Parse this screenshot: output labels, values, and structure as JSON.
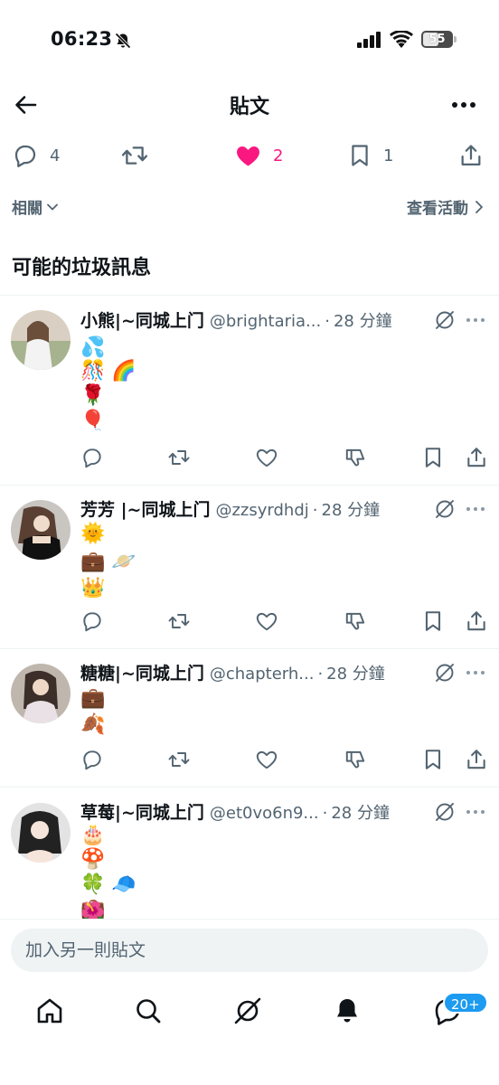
{
  "status_bar": {
    "time": "06:23",
    "battery_level": "55"
  },
  "header": {
    "title": "貼文"
  },
  "engagement": {
    "replies": "4",
    "likes": "2",
    "bookmarks": "1"
  },
  "filters": {
    "related": "相關",
    "view_activity": "查看活動"
  },
  "section": {
    "spam_heading": "可能的垃圾訊息"
  },
  "posts": [
    {
      "name": "小熊|~同城上门",
      "handle": "@brightaria...",
      "dot": "·",
      "time": "28 分鐘",
      "emoji": [
        "💦",
        "🎊 🌈",
        "🌹",
        "🎈"
      ]
    },
    {
      "name": "芳芳 |~同城上门",
      "handle": "@zzsyrdhdj",
      "dot": "·",
      "time": "28 分鐘",
      "emoji": [
        "🌞",
        "💼 🪐",
        "👑"
      ]
    },
    {
      "name": "糖糖|~同城上门",
      "handle": "@chapterh...",
      "dot": "·",
      "time": "28 分鐘",
      "emoji": [
        "💼",
        "🍂"
      ]
    },
    {
      "name": "草莓|~同城上门",
      "handle": "@et0vo6n9...",
      "dot": "·",
      "time": "28 分鐘",
      "emoji": [
        "🎂",
        "🍄",
        "🍀 🧢",
        "💼",
        "🌺"
      ]
    }
  ],
  "composer": {
    "placeholder": "加入另一則貼文"
  },
  "tab_bar": {
    "notification_badge": "20+"
  },
  "colors": {
    "accent": "#1d9bf0",
    "like": "#f91880",
    "muted": "#536471",
    "divider": "#eff3f4"
  }
}
